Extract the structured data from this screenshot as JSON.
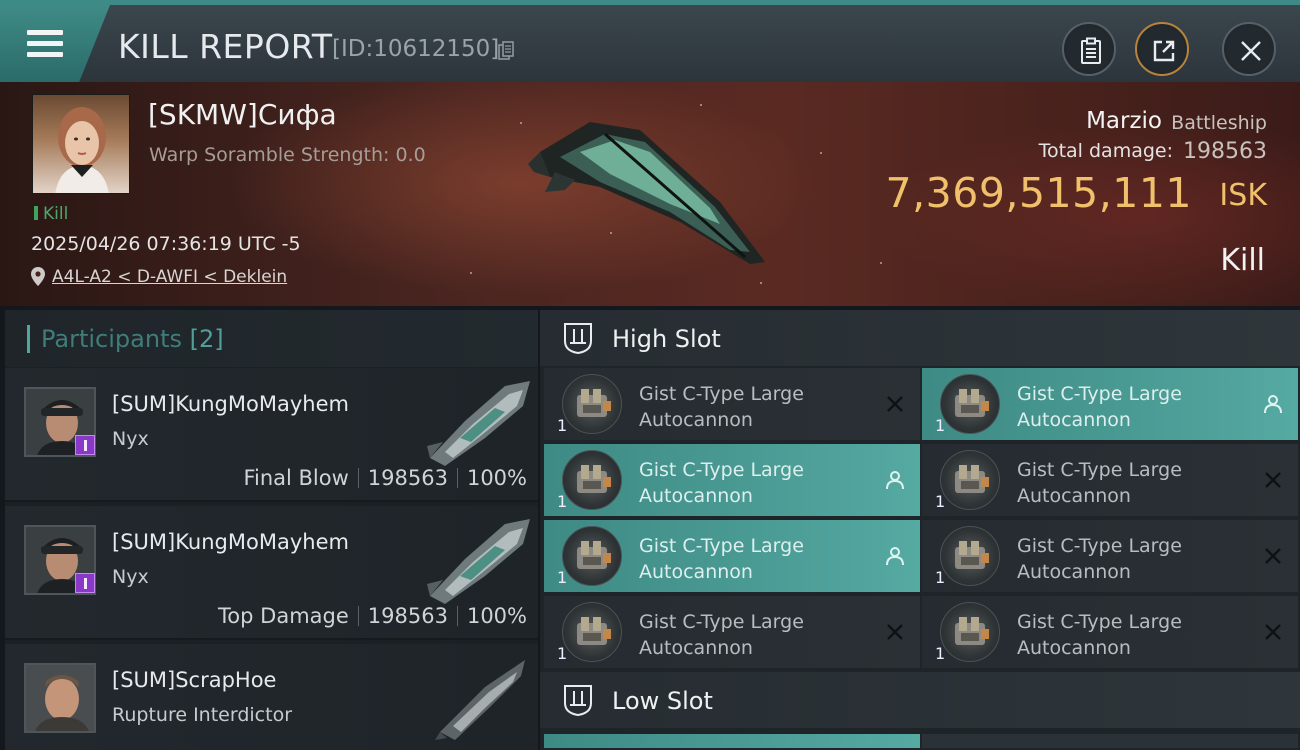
{
  "header": {
    "title": "KILL REPORT",
    "report_id": "[ID:10612150]"
  },
  "victim": {
    "name": "[SKMW]Сифа",
    "warp_scramble": "Warp Soramble Strength: 0.0",
    "tag": "Kill",
    "datetime": "2025/04/26 07:36:19 UTC -5",
    "location": "A4L-A2 < D-AWFI < Deklein"
  },
  "ship": {
    "name": "Marzio",
    "class": "Battleship",
    "damage_label": "Total damage:",
    "damage_value": "198563",
    "isk_value": "7,369,515,111",
    "isk_unit": "ISK",
    "result": "Kill"
  },
  "participants": {
    "title": "Participants",
    "count": "[2]",
    "rows": [
      {
        "name": "[SUM]KungMoMayhem",
        "ship": "Nyx",
        "label": "Final Blow",
        "damage": "198563",
        "percent": "100%"
      },
      {
        "name": "[SUM]KungMoMayhem",
        "ship": "Nyx",
        "label": "Top Damage",
        "damage": "198563",
        "percent": "100%"
      },
      {
        "name": "[SUM]ScrapHoe",
        "ship": "Rupture Interdictor"
      }
    ]
  },
  "high_slot": {
    "title": "High Slot",
    "modules": [
      {
        "name": "Gist C-Type Large Autocannon",
        "qty": "1",
        "status": "destroyed"
      },
      {
        "name": "Gist C-Type Large Autocannon",
        "qty": "1",
        "status": "dropped"
      },
      {
        "name": "Gist C-Type Large Autocannon",
        "qty": "1",
        "status": "dropped"
      },
      {
        "name": "Gist C-Type Large Autocannon",
        "qty": "1",
        "status": "destroyed"
      },
      {
        "name": "Gist C-Type Large Autocannon",
        "qty": "1",
        "status": "dropped"
      },
      {
        "name": "Gist C-Type Large Autocannon",
        "qty": "1",
        "status": "destroyed"
      },
      {
        "name": "Gist C-Type Large Autocannon",
        "qty": "1",
        "status": "destroyed"
      },
      {
        "name": "Gist C-Type Large Autocannon",
        "qty": "1",
        "status": "destroyed"
      }
    ]
  },
  "low_slot": {
    "title": "Low Slot"
  },
  "colors": {
    "accent_teal": "#4d9f98",
    "isk_gold": "#f0c06b",
    "kill_green": "#3fa35e",
    "badge_purple": "#8a38c8"
  }
}
